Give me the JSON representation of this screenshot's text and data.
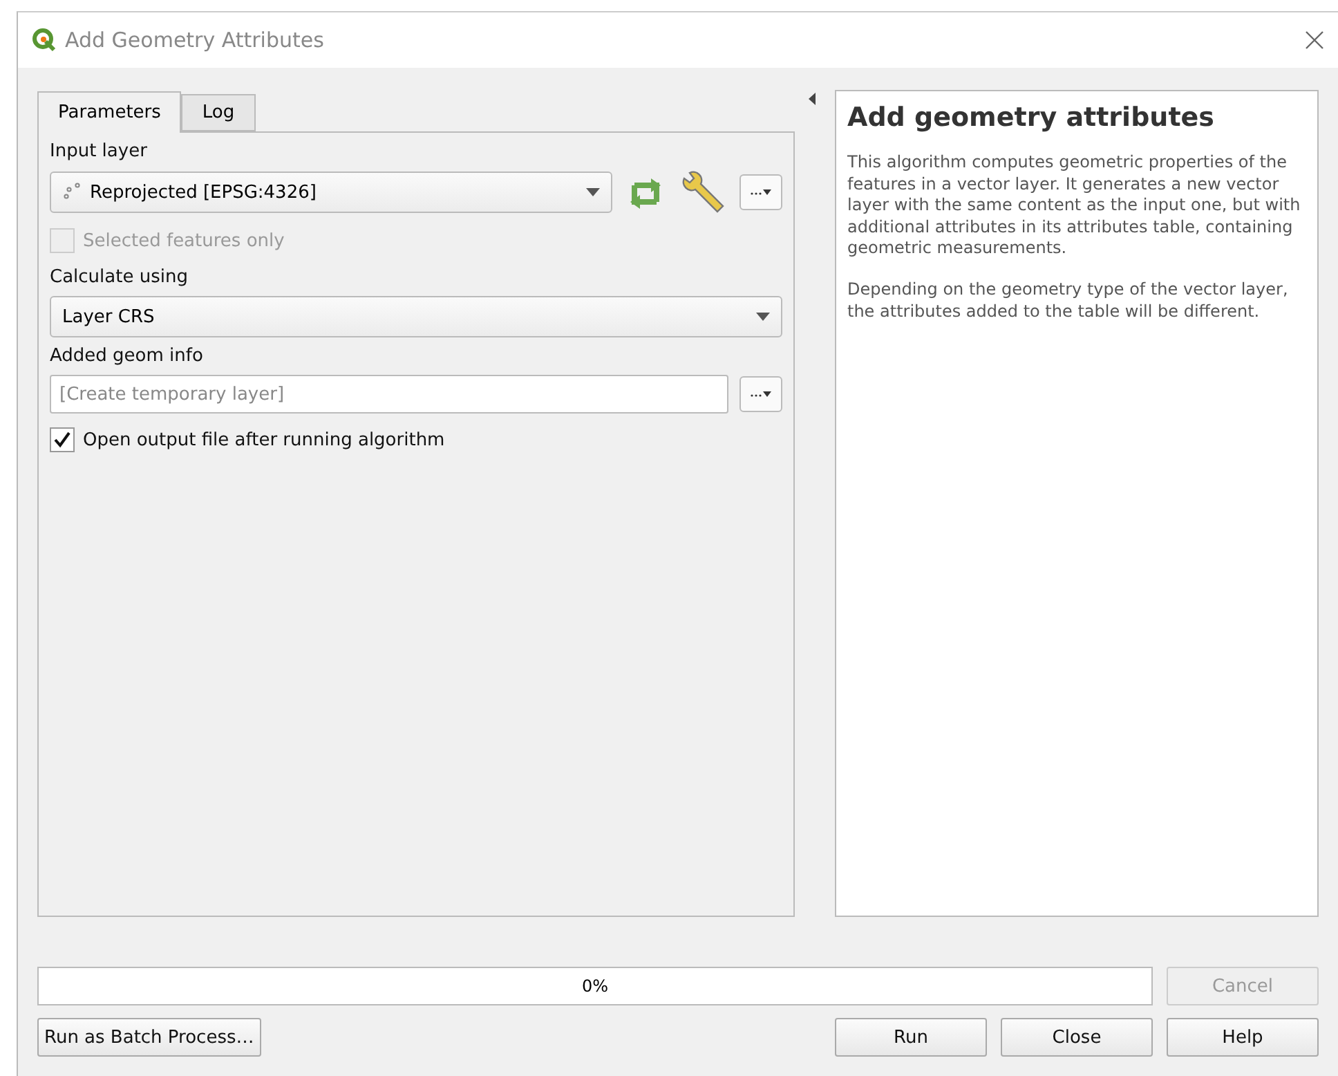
{
  "window": {
    "title": "Add Geometry Attributes"
  },
  "tabs": [
    {
      "label": "Parameters",
      "selected": true
    },
    {
      "label": "Log",
      "selected": false
    }
  ],
  "parameters": [
    {
      "kind": "layer",
      "label": "Input layer",
      "value": "Reprojected [EPSG:4326]"
    },
    {
      "kind": "checkbox",
      "label": "Selected features only",
      "checked": false,
      "disabled": true
    },
    {
      "kind": "select",
      "label": "Calculate using",
      "value": "Layer CRS"
    },
    {
      "kind": "output",
      "label": "Added geom info",
      "placeholder": "[Create temporary layer]"
    },
    {
      "kind": "checkbox",
      "label": "Open output file after running algorithm",
      "checked": true,
      "disabled": false
    }
  ],
  "help": {
    "title": "Add geometry attributes",
    "paragraphs": [
      "This algorithm computes geometric properties of the features in a vector layer. It generates a new vector layer with the same content as the input one, but with additional attributes in its attributes table, containing geometric measurements.",
      "Depending on the geometry type of the vector layer, the attributes added to the table will be different."
    ]
  },
  "progress": {
    "level": 0,
    "reading": "0%"
  },
  "cancel_button": {
    "label": "Cancel",
    "disabled": true
  },
  "batch_button": "Run as Batch Process…",
  "buttons": [
    "Run",
    "Close",
    "Help"
  ]
}
